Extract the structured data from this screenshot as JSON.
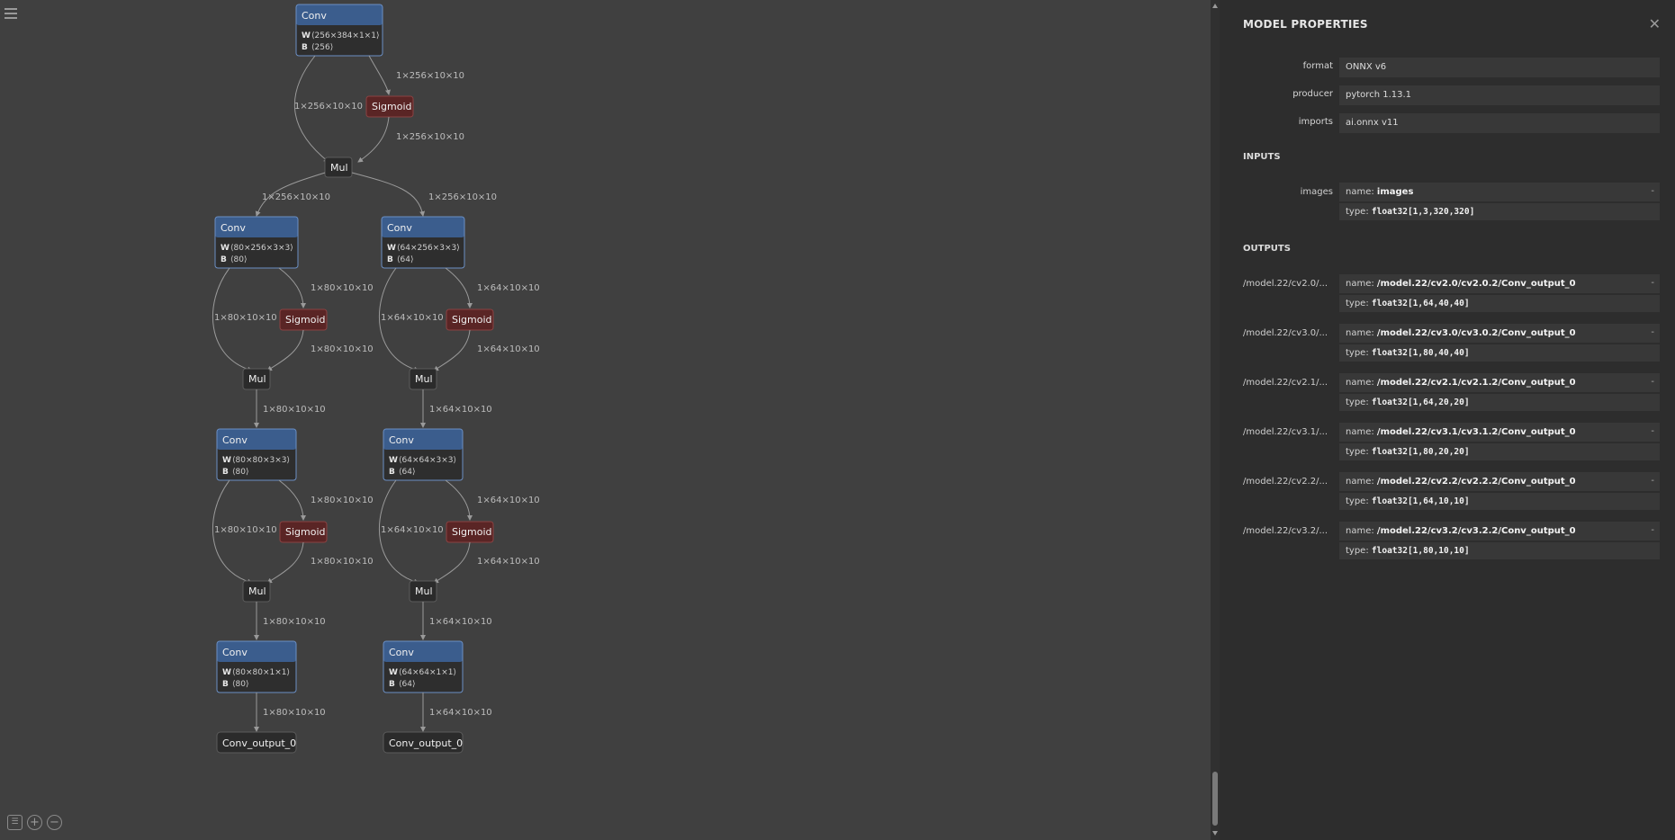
{
  "graph": {
    "top_conv": {
      "title": "Conv",
      "w_key": "W",
      "w_val": "⟨256×384×1×1⟩",
      "b_key": "B",
      "b_val": "⟨256⟩"
    },
    "top_mul": "Mul",
    "sigmoid": "Sigmoid",
    "mul": "Mul",
    "conv": "Conv",
    "edges_top": {
      "left": "1×256×10×10",
      "right_in": "1×256×10×10",
      "right_out": "1×256×10×10",
      "to_left": "1×256×10×10",
      "to_right": "1×256×10×10"
    },
    "left_branch": {
      "conv1": {
        "w_key": "W",
        "w_val": "⟨80×256×3×3⟩",
        "b_key": "B",
        "b_val": "⟨80⟩"
      },
      "conv2": {
        "w_key": "W",
        "w_val": "⟨80×80×3×3⟩",
        "b_key": "B",
        "b_val": "⟨80⟩"
      },
      "conv3": {
        "w_key": "W",
        "w_val": "⟨80×80×1×1⟩",
        "b_key": "B",
        "b_val": "⟨80⟩"
      },
      "edge": "1×80×10×10",
      "output": "Conv_output_0"
    },
    "right_branch": {
      "conv1": {
        "w_key": "W",
        "w_val": "⟨64×256×3×3⟩",
        "b_key": "B",
        "b_val": "⟨64⟩"
      },
      "conv2": {
        "w_key": "W",
        "w_val": "⟨64×64×3×3⟩",
        "b_key": "B",
        "b_val": "⟨64⟩"
      },
      "conv3": {
        "w_key": "W",
        "w_val": "⟨64×64×1×1⟩",
        "b_key": "B",
        "b_val": "⟨64⟩"
      },
      "edge": "1×64×10×10",
      "output": "Conv_output_0"
    }
  },
  "controls": {
    "menu_icon": "hamburger-icon",
    "zoom_fit_icon": "fit-icon",
    "zoom_in_icon": "zoom-in-icon",
    "zoom_out_icon": "zoom-out-icon",
    "zoom_in": "+",
    "zoom_out": "−"
  },
  "panel": {
    "title": "MODEL PROPERTIES",
    "close": "✕",
    "properties": [
      {
        "key": "format",
        "value": "ONNX v6"
      },
      {
        "key": "producer",
        "value": "pytorch 1.13.1"
      },
      {
        "key": "imports",
        "value": "ai.onnx v11"
      }
    ],
    "inputs_label": "INPUTS",
    "inputs": [
      {
        "key": "images",
        "name_label": "name:",
        "name": "images",
        "type_label": "type:",
        "type": "float32[1,3,320,320]",
        "dash": "-"
      }
    ],
    "outputs_label": "OUTPUTS",
    "outputs": [
      {
        "key": "/model.22/cv2.0/...",
        "name_label": "name:",
        "name": "/model.22/cv2.0/cv2.0.2/Conv_output_0",
        "type_label": "type:",
        "type": "float32[1,64,40,40]",
        "dash": "-"
      },
      {
        "key": "/model.22/cv3.0/...",
        "name_label": "name:",
        "name": "/model.22/cv3.0/cv3.0.2/Conv_output_0",
        "type_label": "type:",
        "type": "float32[1,80,40,40]",
        "dash": "-"
      },
      {
        "key": "/model.22/cv2.1/...",
        "name_label": "name:",
        "name": "/model.22/cv2.1/cv2.1.2/Conv_output_0",
        "type_label": "type:",
        "type": "float32[1,64,20,20]",
        "dash": "-"
      },
      {
        "key": "/model.22/cv3.1/...",
        "name_label": "name:",
        "name": "/model.22/cv3.1/cv3.1.2/Conv_output_0",
        "type_label": "type:",
        "type": "float32[1,80,20,20]",
        "dash": "-"
      },
      {
        "key": "/model.22/cv2.2/...",
        "name_label": "name:",
        "name": "/model.22/cv2.2/cv2.2.2/Conv_output_0",
        "type_label": "type:",
        "type": "float32[1,64,10,10]",
        "dash": "-"
      },
      {
        "key": "/model.22/cv3.2/...",
        "name_label": "name:",
        "name": "/model.22/cv3.2/cv3.2.2/Conv_output_0",
        "type_label": "type:",
        "type": "float32[1,80,10,10]",
        "dash": "-"
      }
    ]
  }
}
